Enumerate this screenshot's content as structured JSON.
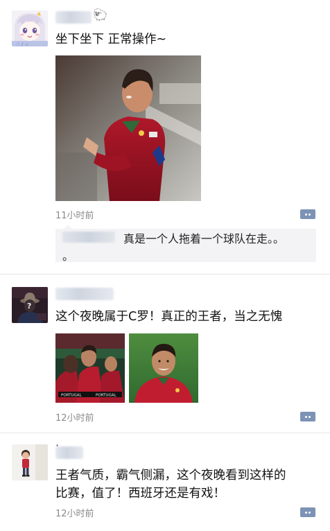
{
  "posts": [
    {
      "text": "坐下坐下 正常操作~",
      "time": "11小时前",
      "emoji": "🐑",
      "comment": {
        "text_line1": "真是一个人拖着一个球队在走。。",
        "text_line2": "。"
      }
    },
    {
      "text": "这个夜晚属于C罗！真正的王者，当之无愧",
      "time": "12小时前",
      "photo_labels": [
        "PORTUGAL"
      ]
    },
    {
      "dot": "·",
      "text_line1": "王者气质，霸气侧漏，这个夜晚看到这样的",
      "text_line2": "比赛，值了！西班牙还是有戏！",
      "time": "12小时前"
    }
  ]
}
